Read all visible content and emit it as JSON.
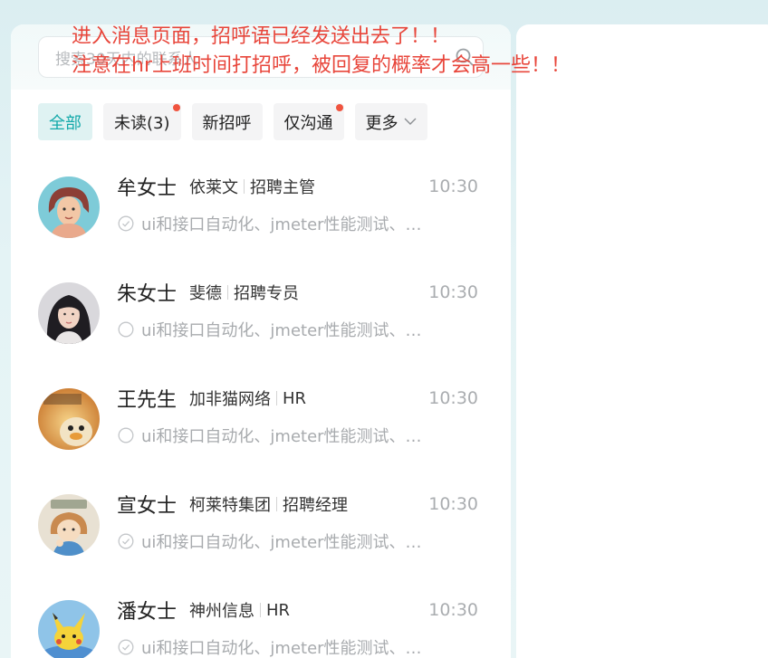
{
  "search": {
    "placeholder": "搜索30天内的联系人"
  },
  "filters": [
    {
      "label": "全部",
      "active": true,
      "unread_dot": false
    },
    {
      "label": "未读(3)",
      "active": false,
      "unread_dot": true
    },
    {
      "label": "新招呼",
      "active": false,
      "unread_dot": false
    },
    {
      "label": "仅沟通",
      "active": false,
      "unread_dot": true
    },
    {
      "label": "更多",
      "active": false,
      "unread_dot": false
    }
  ],
  "conversations": [
    {
      "name": "牟女士",
      "company": "依莱文",
      "title": "招聘主管",
      "time": "10:30",
      "preview": "ui和接口自动化、jmeter性能测试、…",
      "status": "read",
      "avatar": "avatar-cartoon-woman"
    },
    {
      "name": "朱女士",
      "company": "斐德",
      "title": "招聘专员",
      "time": "10:30",
      "preview": "ui和接口自动化、jmeter性能测试、…",
      "status": "unread",
      "avatar": "avatar-photo-woman"
    },
    {
      "name": "王先生",
      "company": "加非猫网络",
      "title": "HR",
      "time": "10:30",
      "preview": "ui和接口自动化、jmeter性能测试、…",
      "status": "unread",
      "avatar": "avatar-friday-duck"
    },
    {
      "name": "宣女士",
      "company": "柯莱特集团",
      "title": "招聘经理",
      "time": "10:30",
      "preview": "ui和接口自动化、jmeter性能测试、…",
      "status": "read",
      "avatar": "avatar-cartoon-girl"
    },
    {
      "name": "潘女士",
      "company": "神州信息",
      "title": "HR",
      "time": "10:30",
      "preview": "ui和接口自动化、jmeter性能测试、…",
      "status": "read",
      "avatar": "avatar-pikachu"
    }
  ],
  "annotations": [
    "进入消息页面，招呼语已经发送出去了！！",
    "注意在hr上班时间打招呼，被回复的概率才会高一些！！"
  ],
  "colors": {
    "accent": "#13a9aa",
    "annotation": "#e8463b",
    "unread_dot": "#f0543f"
  }
}
